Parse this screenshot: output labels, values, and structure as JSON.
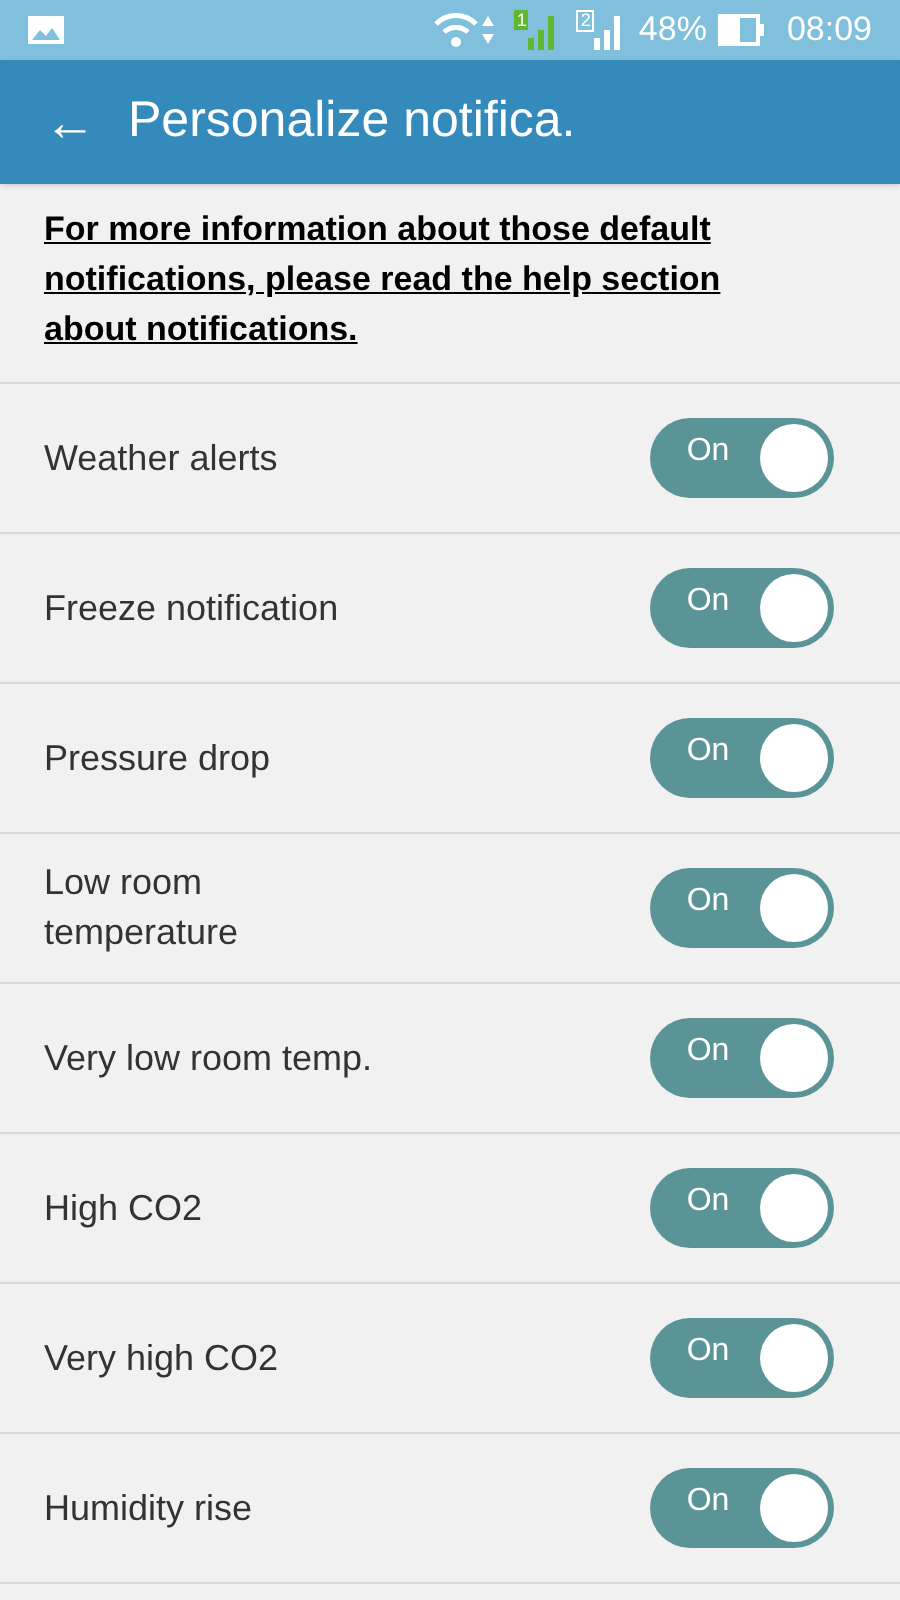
{
  "status_bar": {
    "sim_1": "1",
    "sim_2": "2",
    "battery": "48%",
    "time": "08:09"
  },
  "header": {
    "back": "←",
    "title": "Personalize notifica."
  },
  "intro": {
    "link": "For more information about those default notifications, please read the help section about notifications."
  },
  "settings": [
    {
      "label": "Weather alerts",
      "on": true,
      "switch_text": "On"
    },
    {
      "label": "Freeze notification",
      "on": true,
      "switch_text": "On"
    },
    {
      "label": "Pressure drop",
      "on": true,
      "switch_text": "On"
    },
    {
      "label": "Low room temperature",
      "on": true,
      "switch_text": "On"
    },
    {
      "label": "Very low room temp.",
      "on": true,
      "switch_text": "On"
    },
    {
      "label": "High CO2",
      "on": true,
      "switch_text": "On"
    },
    {
      "label": "Very high CO2",
      "on": true,
      "switch_text": "On"
    },
    {
      "label": "Humidity rise",
      "on": true,
      "switch_text": "On"
    }
  ]
}
